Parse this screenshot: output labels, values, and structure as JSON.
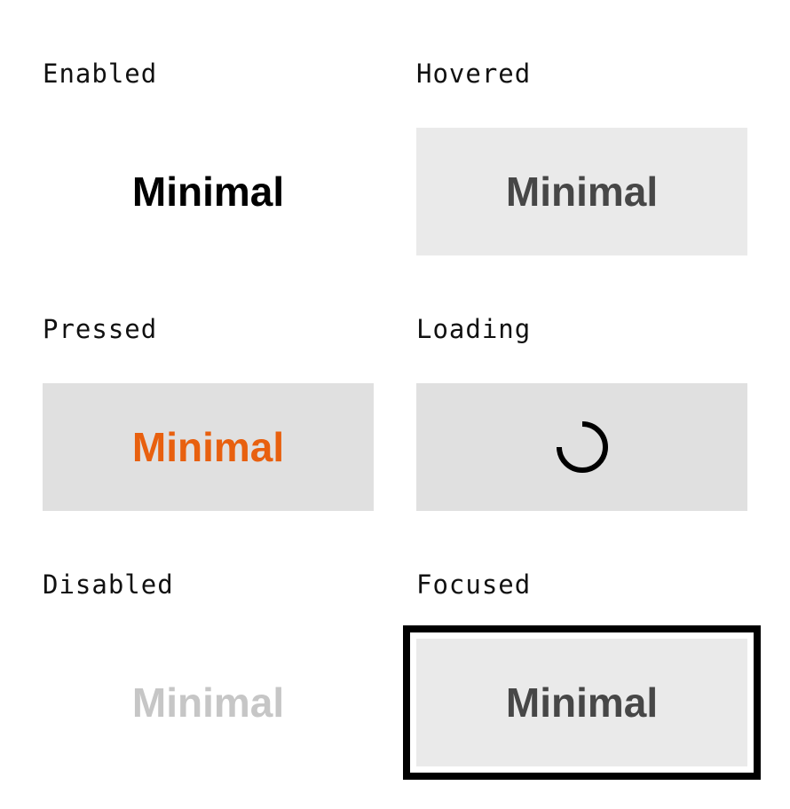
{
  "states": {
    "enabled": {
      "label": "Enabled",
      "button_text": "Minimal"
    },
    "hovered": {
      "label": "Hovered",
      "button_text": "Minimal"
    },
    "pressed": {
      "label": "Pressed",
      "button_text": "Minimal"
    },
    "loading": {
      "label": "Loading",
      "icon": "spinner-icon"
    },
    "disabled": {
      "label": "Disabled",
      "button_text": "Minimal"
    },
    "focused": {
      "label": "Focused",
      "button_text": "Minimal"
    }
  },
  "colors": {
    "text_default": "#000000",
    "text_hover": "#474747",
    "text_pressed": "#e8600f",
    "text_disabled": "#c6c6c6",
    "bg_hover": "#eaeaea",
    "bg_pressed": "#e0e0e0",
    "focus_ring": "#000000"
  }
}
